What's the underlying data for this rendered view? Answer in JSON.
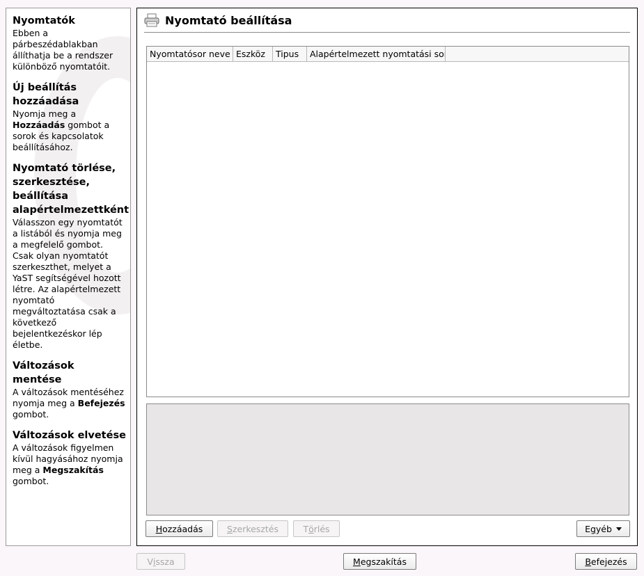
{
  "help": {
    "sections": [
      {
        "title": "Nyomtatók",
        "parts": [
          {
            "text": "Ebben a párbeszédablakban állíthatja be a rendszer különböző nyomtatóit.",
            "bold": false
          }
        ]
      },
      {
        "title": "Új beállítás hozzáadása",
        "parts": [
          {
            "text": "Nyomja meg a ",
            "bold": false
          },
          {
            "text": "Hozzáadás",
            "bold": true
          },
          {
            "text": " gombot a sorok és kapcsolatok beállításához.",
            "bold": false
          }
        ]
      },
      {
        "title": "Nyomtató törlése, szerkesztése, beállítása alapértelmezettként",
        "parts": [
          {
            "text": "Válasszon egy nyomtatót a listából és nyomja meg a megfelelő gombot. Csak olyan nyomtatót szerkeszthet, melyet a YaST segítségével hozott létre. Az alapértelmezett nyomtató megváltoztatása csak a következő bejelentkezéskor lép életbe.",
            "bold": false
          }
        ]
      },
      {
        "title": "Változások mentése",
        "parts": [
          {
            "text": "A változások mentéséhez nyomja meg a ",
            "bold": false
          },
          {
            "text": "Befejezés",
            "bold": true
          },
          {
            "text": " gombot.",
            "bold": false
          }
        ]
      },
      {
        "title": "Változások elvetése",
        "parts": [
          {
            "text": "A változások figyelmen kívül hagyásához nyomja meg a ",
            "bold": false
          },
          {
            "text": "Megszakítás",
            "bold": true
          },
          {
            "text": " gombot.",
            "bold": false
          }
        ]
      }
    ]
  },
  "main": {
    "title": "Nyomtató beállítása",
    "icon": "printer-icon",
    "table": {
      "columns": [
        "Nyomtatósor neve",
        "Eszköz",
        "Tipus",
        "Alapértelmezett nyomtatási sor"
      ],
      "rows": []
    },
    "buttons": {
      "add": {
        "pre": "",
        "key": "H",
        "post": "ozzáadás",
        "enabled": true
      },
      "edit": {
        "pre": "",
        "key": "S",
        "post": "zerkesztés",
        "enabled": false
      },
      "delete": {
        "pre": "T",
        "key": "ö",
        "post": "rlés",
        "enabled": false
      },
      "other": {
        "pre": "E",
        "key": "g",
        "post": "yéb",
        "enabled": true
      }
    }
  },
  "footer": {
    "back": {
      "pre": "V",
      "key": "i",
      "post": "ssza",
      "enabled": false
    },
    "abort": {
      "pre": "",
      "key": "M",
      "post": "egszakítás",
      "enabled": true
    },
    "finish": {
      "pre": "",
      "key": "B",
      "post": "efejezés",
      "enabled": true
    }
  }
}
